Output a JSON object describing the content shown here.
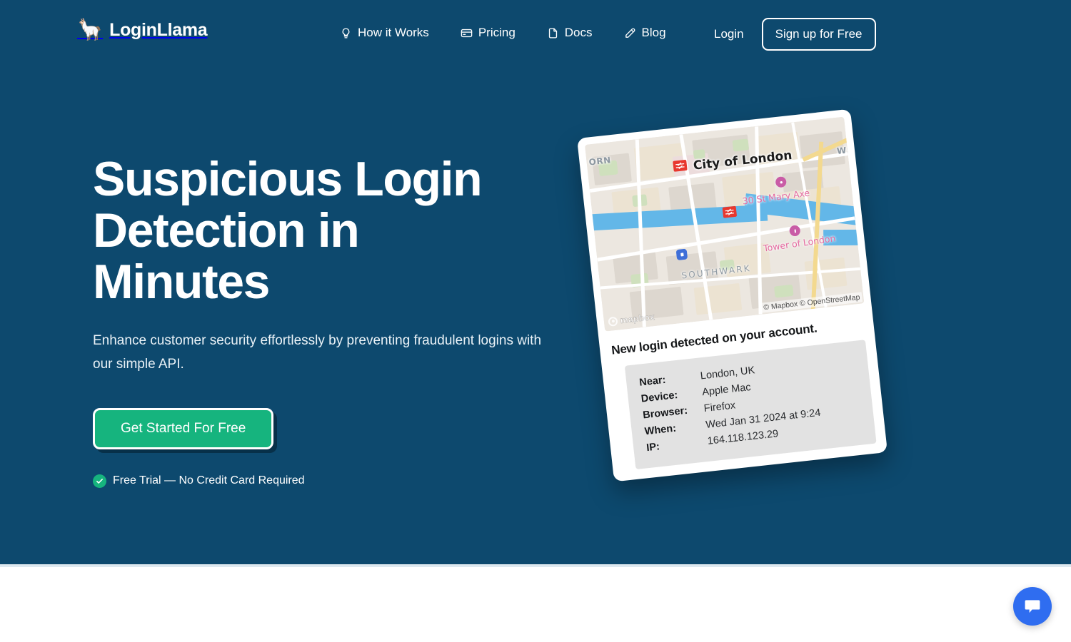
{
  "header": {
    "brand": {
      "llama_glyph": "🦙",
      "name": "LoginLlama",
      "icon": "llama-icon"
    },
    "nav": [
      {
        "label": "How it Works",
        "icon": "lightbulb-icon"
      },
      {
        "label": "Pricing",
        "icon": "credit-card-icon"
      },
      {
        "label": "Docs",
        "icon": "file-icon"
      },
      {
        "label": "Blog",
        "icon": "pencil-icon"
      }
    ],
    "login_label": "Login",
    "signup_label": "Sign up for Free"
  },
  "hero": {
    "headline": "Suspicious Login Detection in Minutes",
    "subhead": "Enhance customer security effortlessly by preventing fraudulent logins with our simple API.",
    "cta_label": "Get Started For Free",
    "trust_text": "Free Trial — No Credit Card Required",
    "trust_icon": "check-circle-icon"
  },
  "notification_card": {
    "map": {
      "labels": {
        "city": "City of London",
        "poi_st_mary_axe": "30 St Mary Axe",
        "poi_tower": "Tower of London",
        "neighbourhood": "SOUTHWARK",
        "edge_left": "ORN",
        "edge_right": "WH"
      },
      "watermark": "mapbox",
      "attribution": "© Mapbox © OpenStreetMap"
    },
    "title": "New login detected on your account.",
    "details": [
      {
        "key": "Near:",
        "value": "London, UK"
      },
      {
        "key": "Device:",
        "value": "Apple Mac"
      },
      {
        "key": "Browser:",
        "value": "Firefox"
      },
      {
        "key": "When:",
        "value": "Wed Jan 31 2024 at 9:24"
      },
      {
        "key": "IP:",
        "value": "164.118.123.29"
      }
    ]
  },
  "chat": {
    "icon": "chat-bubble-icon"
  },
  "colors": {
    "hero_background": "#0d496e",
    "accent_green": "#16b47e",
    "chat_blue": "#2f6df0",
    "text_white": "#ffffff",
    "divider": "#dde8ef"
  }
}
